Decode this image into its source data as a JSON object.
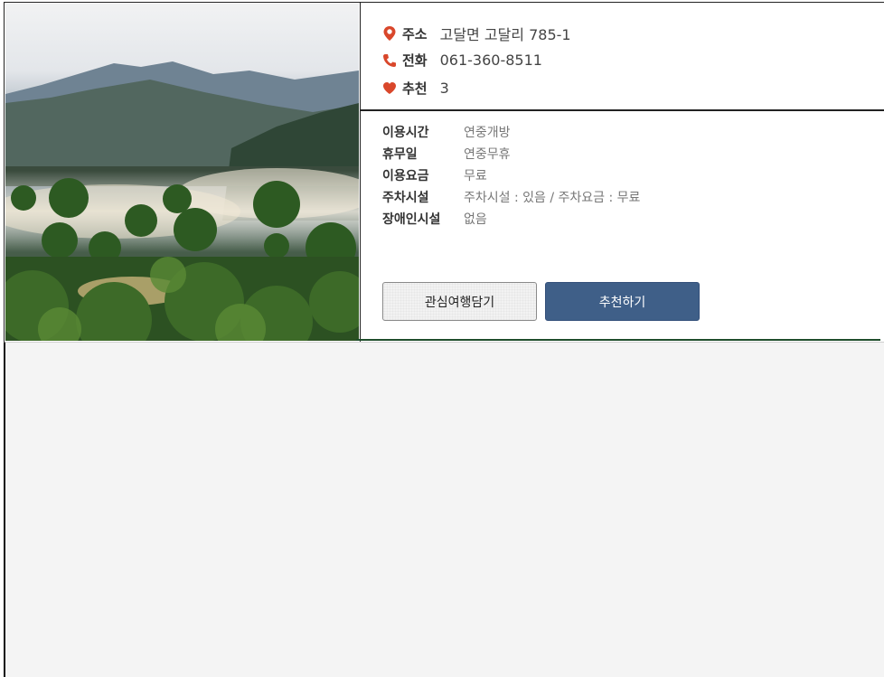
{
  "info": {
    "address_label": "주소",
    "address": "고달면 고달리 785-1",
    "phone_label": "전화",
    "phone": "061-360-8511",
    "recommend_label": "추천",
    "recommend_count": "3"
  },
  "details": [
    {
      "key": "이용시간",
      "value": "연중개방"
    },
    {
      "key": "휴무일",
      "value": "연중무휴"
    },
    {
      "key": "이용요금",
      "value": "무료"
    },
    {
      "key": "주차시설",
      "value": "주차시설 : 있음 / 주차요금 : 무료"
    },
    {
      "key": "장애인시설",
      "value": "없음"
    }
  ],
  "buttons": {
    "favorite": "관심여행담기",
    "recommend": "추천하기"
  },
  "icons": {
    "address": "map-pin-icon",
    "phone": "phone-icon",
    "recommend": "heart-icon"
  },
  "colors": {
    "icon_accent": "#d9472b",
    "recommend_button": "#3f5f88",
    "favorite_button": "#f2f2f2"
  }
}
